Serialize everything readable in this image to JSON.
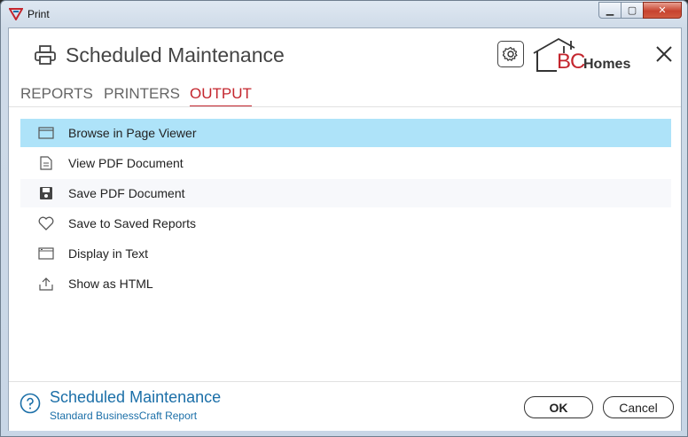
{
  "window": {
    "title": "Print",
    "minimize_label": "▁",
    "maximize_label": "▢",
    "close_label": "✕"
  },
  "header": {
    "title": "Scheduled Maintenance",
    "logo": {
      "bc": "BC",
      "homes": "Homes"
    }
  },
  "tabs": [
    {
      "label": "REPORTS"
    },
    {
      "label": "PRINTERS"
    },
    {
      "label": "OUTPUT"
    }
  ],
  "active_tab": "OUTPUT",
  "output_options": [
    {
      "label": "Browse in Page Viewer",
      "icon": "window-icon",
      "selected": true
    },
    {
      "label": "View PDF Document",
      "icon": "document-icon",
      "selected": false
    },
    {
      "label": "Save PDF Document",
      "icon": "save-icon",
      "selected": false
    },
    {
      "label": "Save to Saved Reports",
      "icon": "heart-icon",
      "selected": false
    },
    {
      "label": "Display in Text",
      "icon": "text-window-icon",
      "selected": false
    },
    {
      "label": "Show as HTML",
      "icon": "export-icon",
      "selected": false
    }
  ],
  "footer": {
    "title": "Scheduled Maintenance",
    "subtitle": "Standard BusinessCraft Report",
    "ok_label": "OK",
    "cancel_label": "Cancel"
  },
  "colors": {
    "accent": "#c4262e",
    "selection": "#aee3f9",
    "link_blue": "#1b6fa8"
  }
}
